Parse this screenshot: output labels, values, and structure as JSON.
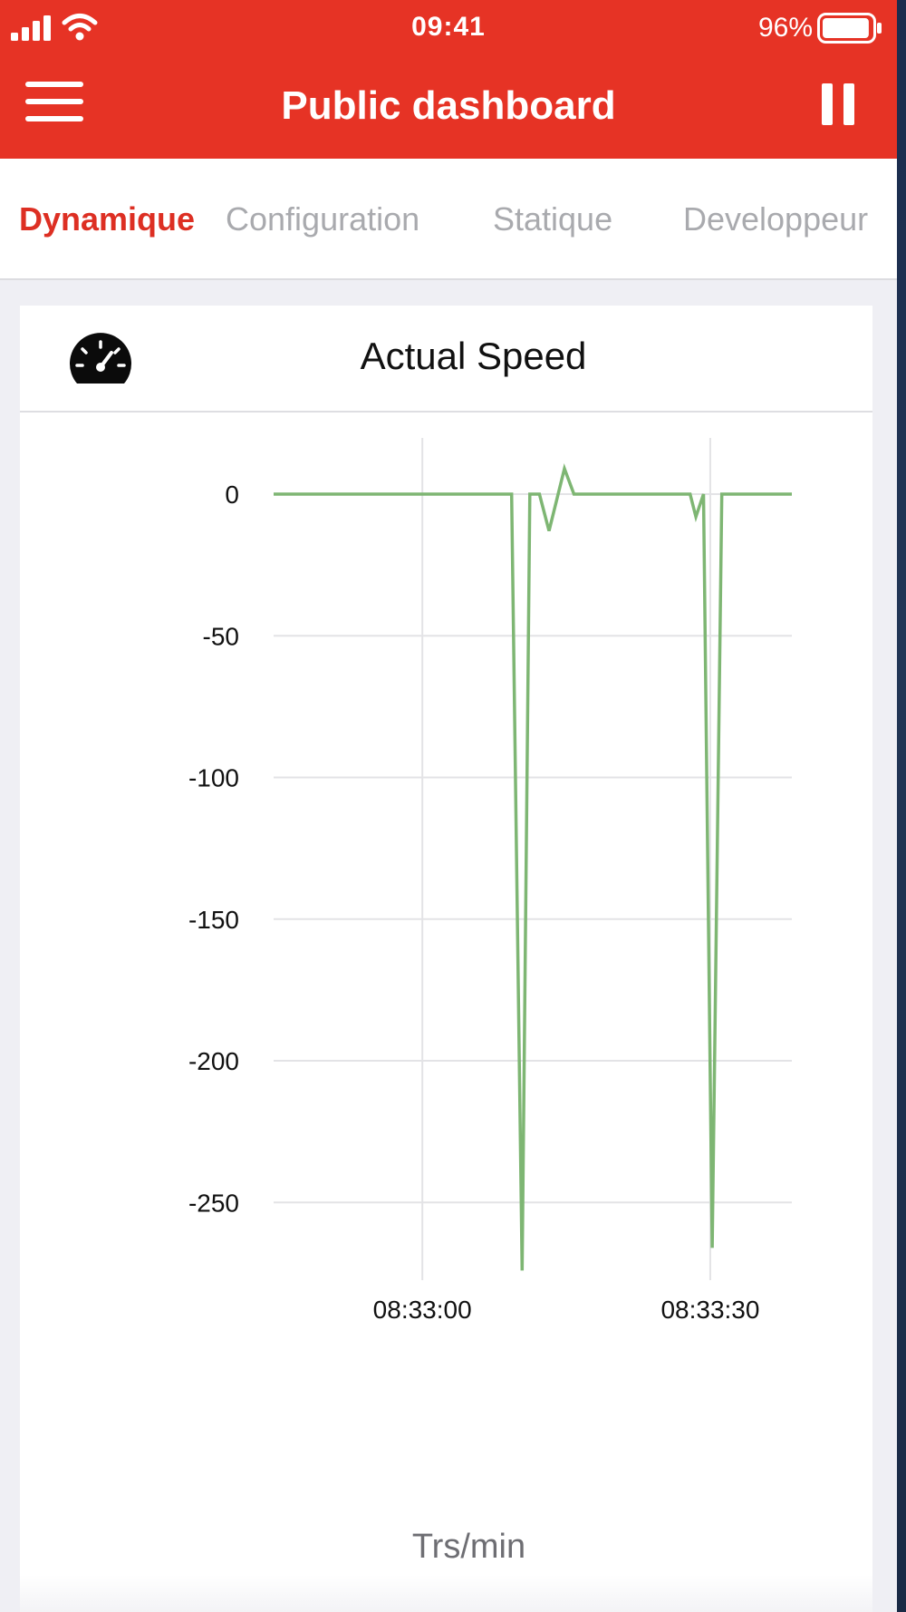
{
  "status_bar": {
    "time": "09:41",
    "battery": "96%",
    "battery_level": 0.96
  },
  "navbar": {
    "title": "Public dashboard"
  },
  "tabs": [
    {
      "label": "Dynamique",
      "active": true
    },
    {
      "label": "Configuration",
      "active": false
    },
    {
      "label": "Statique",
      "active": false
    },
    {
      "label": "Developpeur",
      "active": false
    }
  ],
  "card": {
    "title": "Actual Speed",
    "icon": "speedometer-icon",
    "unit": "Trs/min"
  },
  "colors": {
    "accent": "#e63325",
    "active_tab": "#dd2f23",
    "series": "#7eb673"
  },
  "chart_data": {
    "type": "line",
    "title": "Actual Speed",
    "xlabel": "Trs/min",
    "ylabel": "",
    "ylim": [
      -275,
      10
    ],
    "yticks": [
      0,
      -50,
      -100,
      -150,
      -200,
      -250
    ],
    "xtick_labels": [
      "08:33:00",
      "08:33:30"
    ],
    "xtick_seconds": [
      0,
      30
    ],
    "xlim": [
      -15.5,
      38.5
    ],
    "grid": true,
    "series": [
      {
        "x": [
          -15.5,
          9.3,
          10.4,
          11.2,
          12.2,
          13.2,
          14.8,
          15.8,
          27.9,
          28.5,
          29.3,
          30.2,
          31.2,
          38.5
        ],
        "y": [
          0,
          0,
          -274,
          0,
          0,
          -13,
          9,
          0,
          0,
          -8,
          0,
          -266,
          0,
          0
        ]
      }
    ]
  }
}
